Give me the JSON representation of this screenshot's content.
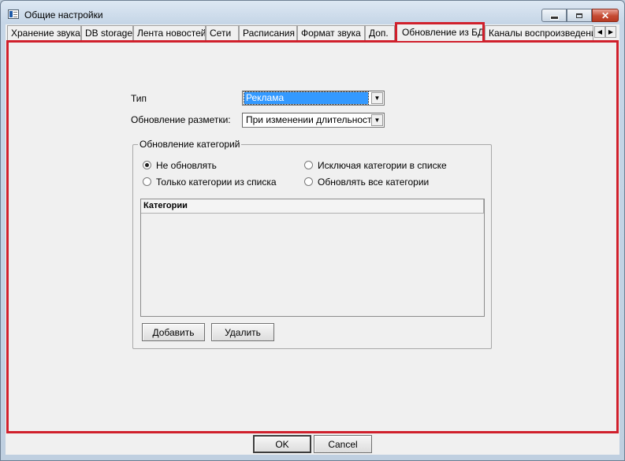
{
  "window": {
    "title": "Общие настройки",
    "minimize_glyph": "",
    "maximize_glyph": "",
    "close_glyph": "✕"
  },
  "tabs": [
    {
      "label": "Хранение звука",
      "active": false
    },
    {
      "label": "DB storage",
      "active": false
    },
    {
      "label": "Лента новостей",
      "active": false
    },
    {
      "label": "Сети",
      "active": false
    },
    {
      "label": "Расписания",
      "active": false
    },
    {
      "label": "Формат звука",
      "active": false
    },
    {
      "label": "Доп.",
      "active": false
    },
    {
      "label": "Обновление из БД",
      "active": true
    },
    {
      "label": "Каналы воспроизведения",
      "active": false
    }
  ],
  "tab_scroll": {
    "left": "◀",
    "right": "▶"
  },
  "form": {
    "type_label": "Тип",
    "type_value": "Реклама",
    "markup_label": "Обновление разметки:",
    "markup_value": "При изменении длительности",
    "combo_arrow": "▼"
  },
  "category_group": {
    "legend": "Обновление категорий",
    "options": [
      {
        "label": "Не обновлять",
        "checked": true
      },
      {
        "label": "Исключая категории в списке",
        "checked": false
      },
      {
        "label": "Только категории из списка",
        "checked": false
      },
      {
        "label": "Обновлять все категории",
        "checked": false
      }
    ],
    "list_header": "Категории",
    "add_label": "Добавить",
    "delete_label": "Удалить"
  },
  "footer": {
    "ok_label": "OK",
    "cancel_label": "Cancel"
  },
  "colors": {
    "highlight_border": "#d0202c",
    "selection": "#3399ff"
  }
}
